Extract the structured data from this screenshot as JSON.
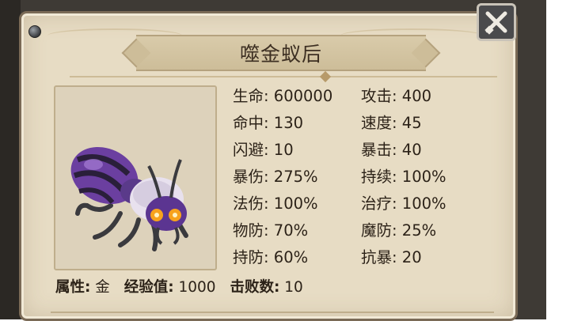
{
  "panel": {
    "title": "噬金蚁后"
  },
  "portrait": {
    "icon": "ant-queen-portrait"
  },
  "stats_left": [
    {
      "label": "生命",
      "value": "600000"
    },
    {
      "label": "命中",
      "value": "130"
    },
    {
      "label": "闪避",
      "value": "10"
    },
    {
      "label": "暴伤",
      "value": "275%"
    },
    {
      "label": "法伤",
      "value": "100%"
    },
    {
      "label": "物防",
      "value": "70%"
    },
    {
      "label": "持防",
      "value": "60%"
    }
  ],
  "stats_right": [
    {
      "label": "攻击",
      "value": "400"
    },
    {
      "label": "速度",
      "value": "45"
    },
    {
      "label": "暴击",
      "value": "40"
    },
    {
      "label": "持续",
      "value": "100%"
    },
    {
      "label": "治疗",
      "value": "100%"
    },
    {
      "label": "魔防",
      "value": "25%"
    },
    {
      "label": "抗暴",
      "value": "20"
    }
  ],
  "footer": {
    "attribute_label": "属性:",
    "attribute_value": "金",
    "exp_label": "经验值:",
    "exp_value": "1000",
    "kills_label": "击败数:",
    "kills_value": "10"
  },
  "close_button": {
    "icon": "crossed-swords-close-icon"
  },
  "colors": {
    "parchment": "#e7dcc4",
    "frame": "#3e3a35",
    "text": "#2c2218"
  }
}
